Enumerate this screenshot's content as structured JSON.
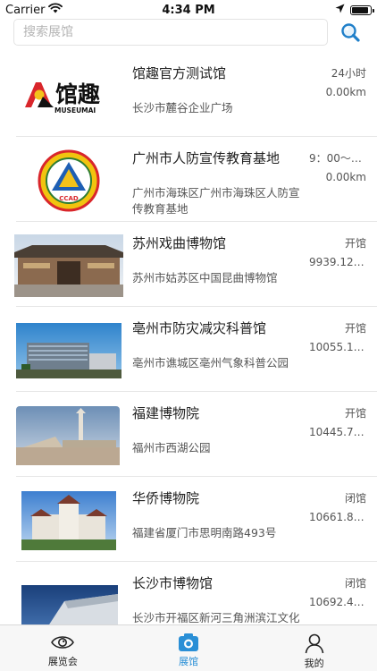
{
  "status_bar": {
    "carrier": "Carrier",
    "time": "4:34 PM",
    "battery_level": 0.9
  },
  "search": {
    "placeholder": "搜索展馆",
    "value": ""
  },
  "museums": [
    {
      "name": "馆趣官方测试馆",
      "status": "24小时",
      "distance": "0.00km",
      "address": "长沙市麓谷企业广场",
      "logo_text": "馆趣",
      "logo_subtext": "MUSEUMAI"
    },
    {
      "name": "广州市人防宣传教育基地",
      "status": "9：00～1...",
      "distance": "0.00km",
      "address": "广州市海珠区广州市海珠区人防宣传教育基地",
      "logo_text": "CCAD"
    },
    {
      "name": "苏州戏曲博物馆",
      "status": "开馆",
      "distance": "9939.12km",
      "address": "苏州市姑苏区中国昆曲博物馆"
    },
    {
      "name": "亳州市防灾减灾科普馆",
      "status": "开馆",
      "distance": "10055.13...",
      "address": "亳州市谯城区亳州气象科普公园"
    },
    {
      "name": "福建博物院",
      "status": "开馆",
      "distance": "10445.75...",
      "address": "福州市西湖公园"
    },
    {
      "name": "华侨博物院",
      "status": "闭馆",
      "distance": "10661.83...",
      "address": "福建省厦门市思明南路493号"
    },
    {
      "name": "长沙市博物馆",
      "status": "闭馆",
      "distance": "10692.47...",
      "address": "长沙市开福区新河三角洲滨江文化园"
    }
  ],
  "tabs": [
    {
      "label": "展览会",
      "icon": "eye-icon",
      "active": false
    },
    {
      "label": "展馆",
      "icon": "museum-icon",
      "active": true
    },
    {
      "label": "我的",
      "icon": "person-icon",
      "active": false
    }
  ],
  "colors": {
    "accent": "#2a8fd6",
    "logo_red": "#d9262b",
    "logo_yellow": "#f3c21b"
  }
}
